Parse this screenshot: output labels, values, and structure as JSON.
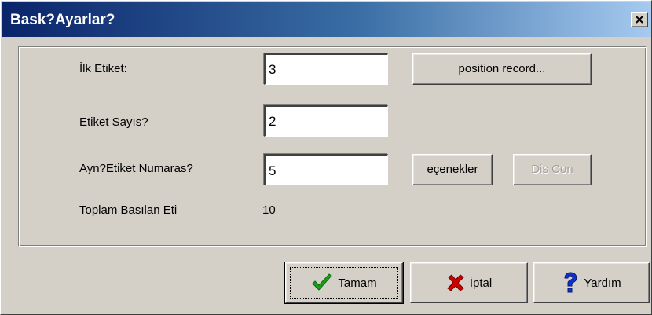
{
  "window": {
    "title": "Bask?Ayarlar?"
  },
  "form": {
    "first_label": {
      "label": "İlk Etiket:",
      "value": "3"
    },
    "label_count": {
      "label": "Etiket Sayıs?",
      "value": "2"
    },
    "same_label_number": {
      "label": "Ayn?Etiket Numaras?",
      "value": "5"
    },
    "total_printed": {
      "label": "Toplam Basılan Eti",
      "value": "10"
    }
  },
  "buttons": {
    "position_record": "position record...",
    "options": "eçenekler",
    "dis_con": "Dis Con",
    "ok": "Tamam",
    "cancel": "İptal",
    "help": "Yardım"
  },
  "icons": {
    "close": "close-icon",
    "ok": "checkmark-icon",
    "cancel": "x-icon",
    "help": "question-mark-icon"
  },
  "colors": {
    "title_start": "#0a246a",
    "title_end": "#a6caf0",
    "face": "#d4d0c8",
    "check_green": "#18a018",
    "cancel_red": "#d00000",
    "help_blue": "#1030d0"
  }
}
